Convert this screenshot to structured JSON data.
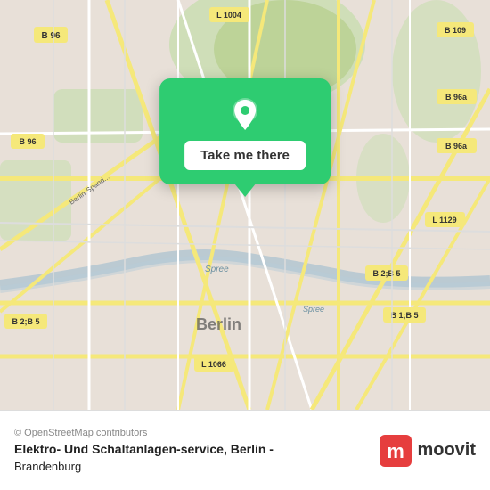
{
  "map": {
    "bg_color": "#e8e0d8",
    "center_city": "Berlin",
    "popup": {
      "button_label": "Take me there"
    }
  },
  "bottom_bar": {
    "copyright": "© OpenStreetMap contributors",
    "location_name": "Elektro- Und Schaltanlagen-service, Berlin -",
    "location_sub": "Brandenburg",
    "moovit_label": "moovit"
  }
}
